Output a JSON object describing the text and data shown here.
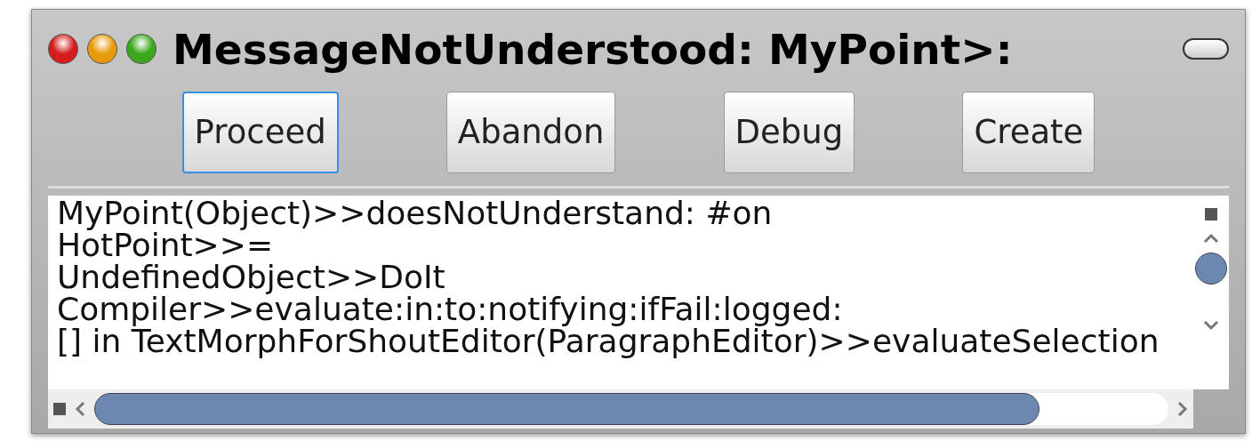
{
  "window": {
    "title": "MessageNotUnderstood: MyPoint>:"
  },
  "buttons": [
    {
      "label": "Proceed",
      "focused": true
    },
    {
      "label": "Abandon",
      "focused": false
    },
    {
      "label": "Debug",
      "focused": false
    },
    {
      "label": "Create",
      "focused": false
    }
  ],
  "stack": [
    "MyPoint(Object)>>doesNotUnderstand: #on",
    "HotPoint>>=",
    "UndefinedObject>>DoIt",
    "Compiler>>evaluate:in:to:notifying:ifFail:logged:",
    "[] in TextMorphForShoutEditor(ParagraphEditor)>>evaluateSelection"
  ]
}
